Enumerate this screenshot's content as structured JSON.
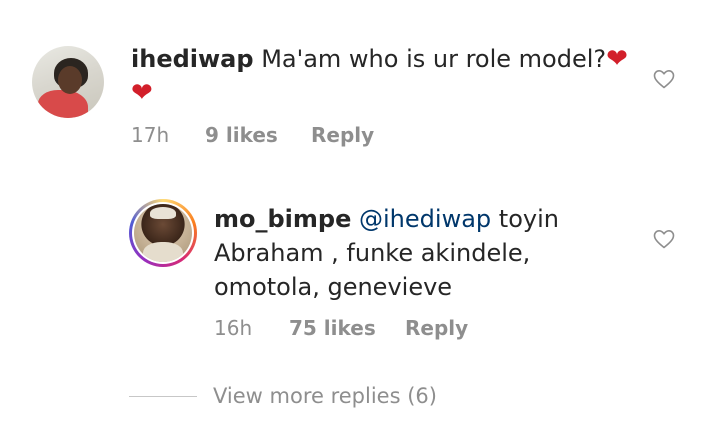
{
  "comments": [
    {
      "username": "ihediwap",
      "text": "Ma'am who is ur role model?",
      "emoji": "❤",
      "time": "17h",
      "likes": "9 likes",
      "reply": "Reply",
      "avatar_icon": "profile-photo"
    },
    {
      "username": "mo_bimpe",
      "mention": "@ihediwap",
      "text_line1": "toyin",
      "text_line2": "Abraham , funke akindele,",
      "text_line3": "omotola, genevieve",
      "time": "16h",
      "likes": "75 likes",
      "reply": "Reply",
      "avatar_icon": "profile-photo-story-ring"
    }
  ],
  "view_more": "View more replies (6)",
  "colors": {
    "text": "#262626",
    "meta": "#8e8e8e",
    "mention": "#00376b",
    "heart": "#d21f2a"
  },
  "icons": {
    "like": "heart-outline-icon"
  }
}
